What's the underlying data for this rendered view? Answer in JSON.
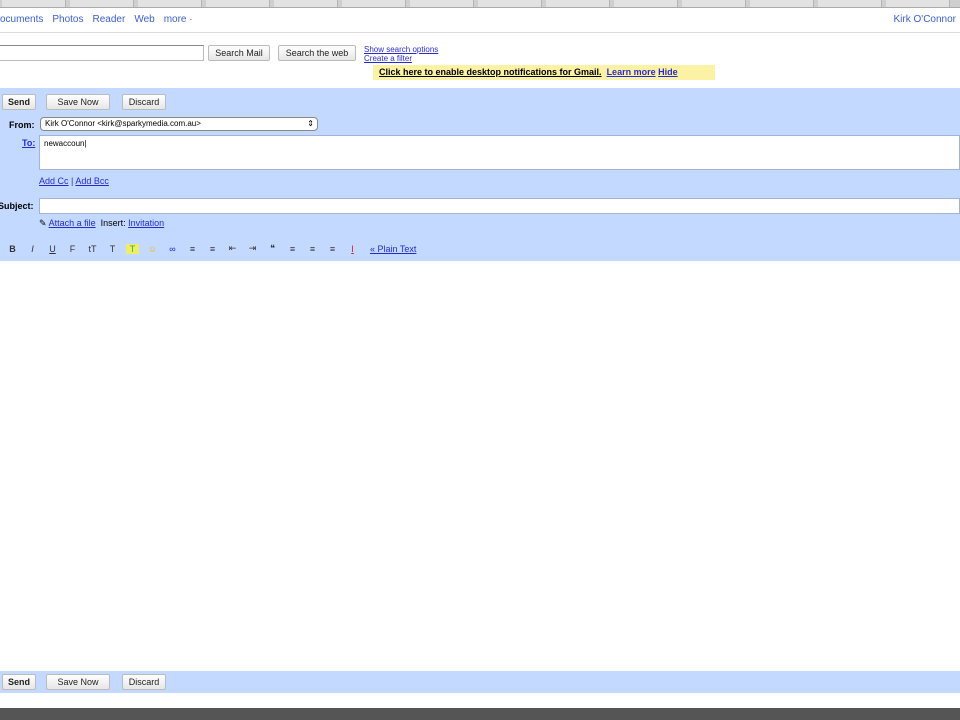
{
  "nav": {
    "items": [
      "ocuments",
      "Photos",
      "Reader",
      "Web",
      "more ·"
    ],
    "user": "Kirk O'Connor"
  },
  "search": {
    "mail_button": "Search Mail",
    "web_button": "Search the web",
    "show_options": "Show search options",
    "create_filter": "Create a filter"
  },
  "notification": {
    "text": "Click here to enable desktop notifications for Gmail.",
    "learn_more": "Learn more",
    "hide": "Hide"
  },
  "compose": {
    "send": "Send",
    "save_now": "Save Now",
    "discard": "Discard",
    "from_label": "From:",
    "from_value": "Kirk O'Connor <kirk@sparkymedia.com.au>",
    "to_label": "To:",
    "to_value": "newaccoun",
    "add_cc": "Add Cc",
    "separator": "|",
    "add_bcc": "Add Bcc",
    "subject_label": "Subject:",
    "subject_value": "",
    "attach": "Attach a file",
    "insert_label": "Insert:",
    "invitation": "Invitation",
    "plain_text": "« Plain Text"
  },
  "toolbar": {
    "icons": [
      "B",
      "I",
      "U",
      "F",
      "tT",
      "T",
      "T",
      "☺",
      "∞",
      "≡",
      "≡",
      "⇤",
      "⇥",
      "❝",
      "≡",
      "≡",
      "≡",
      "I"
    ]
  }
}
